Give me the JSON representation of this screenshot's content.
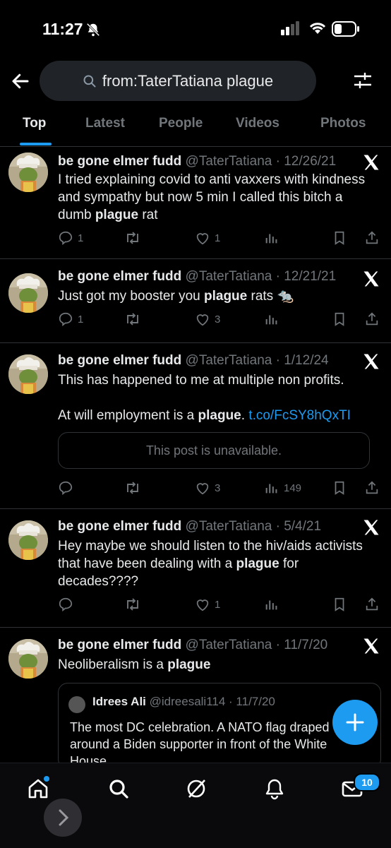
{
  "status_bar": {
    "time": "11:27"
  },
  "search": {
    "query": "from:TaterTatiana plague"
  },
  "tabs": [
    {
      "label": "Top"
    },
    {
      "label": "Latest"
    },
    {
      "label": "People"
    },
    {
      "label": "Videos"
    },
    {
      "label": "Photos"
    }
  ],
  "tweets": [
    {
      "name": "be gone elmer fudd",
      "handle": "@TaterTatiana",
      "date": "· 12/26/21",
      "text_parts": [
        "I tried explaining covid to anti vaxxers with kindness and sympathy but now 5 min I called this bitch a dumb ",
        "plague",
        " rat"
      ],
      "replies": "1",
      "reposts": "",
      "likes": "1",
      "views": ""
    },
    {
      "name": "be gone elmer fudd",
      "handle": "@TaterTatiana",
      "date": "· 12/21/21",
      "text_parts": [
        "Just got my booster you ",
        "plague",
        " rats ",
        "🐀"
      ],
      "replies": "1",
      "reposts": "",
      "likes": "3",
      "views": ""
    },
    {
      "name": "be gone elmer fudd",
      "handle": "@TaterTatiana",
      "date": "· 1/12/24",
      "text_parts": [
        "This has happened to me at multiple non profits.",
        "At will employment is a ",
        "plague",
        ". ",
        "t.co/FcSY8hQxTI"
      ],
      "unavailable": "This post is unavailable.",
      "replies": "",
      "reposts": "",
      "likes": "3",
      "views": "149"
    },
    {
      "name": "be gone elmer fudd",
      "handle": "@TaterTatiana",
      "date": "· 5/4/21",
      "text_parts": [
        "Hey maybe we should listen to the hiv/aids activists that have been dealing with a ",
        "plague",
        " for decades????"
      ],
      "replies": "",
      "reposts": "",
      "likes": "1",
      "views": ""
    },
    {
      "name": "be gone elmer fudd",
      "handle": "@TaterTatiana",
      "date": "· 11/7/20",
      "text_parts": [
        "Neoliberalism is a ",
        "plague"
      ],
      "quote": {
        "name": "Idrees Ali",
        "handle": "@idreesali114",
        "date": "· 11/7/20",
        "text": "The most DC celebration. A NATO flag draped around a Biden supporter in front of the White House."
      }
    }
  ],
  "nav": {
    "messages_badge": "10"
  },
  "icons": {
    "back": "arrow-left-icon",
    "search": "search-icon",
    "filter": "sliders-icon",
    "x": "x-logo-icon",
    "reply": "reply-icon",
    "repost": "repost-icon",
    "like": "heart-icon",
    "views": "views-icon",
    "bookmark": "bookmark-icon",
    "share": "share-icon",
    "home": "home-icon",
    "explore": "search-icon",
    "grok": "grok-icon",
    "notifications": "bell-icon",
    "messages": "mail-icon",
    "compose": "plus-icon"
  },
  "colors": {
    "accent": "#1d9bf0",
    "background": "#000000",
    "muted": "#71767b"
  }
}
